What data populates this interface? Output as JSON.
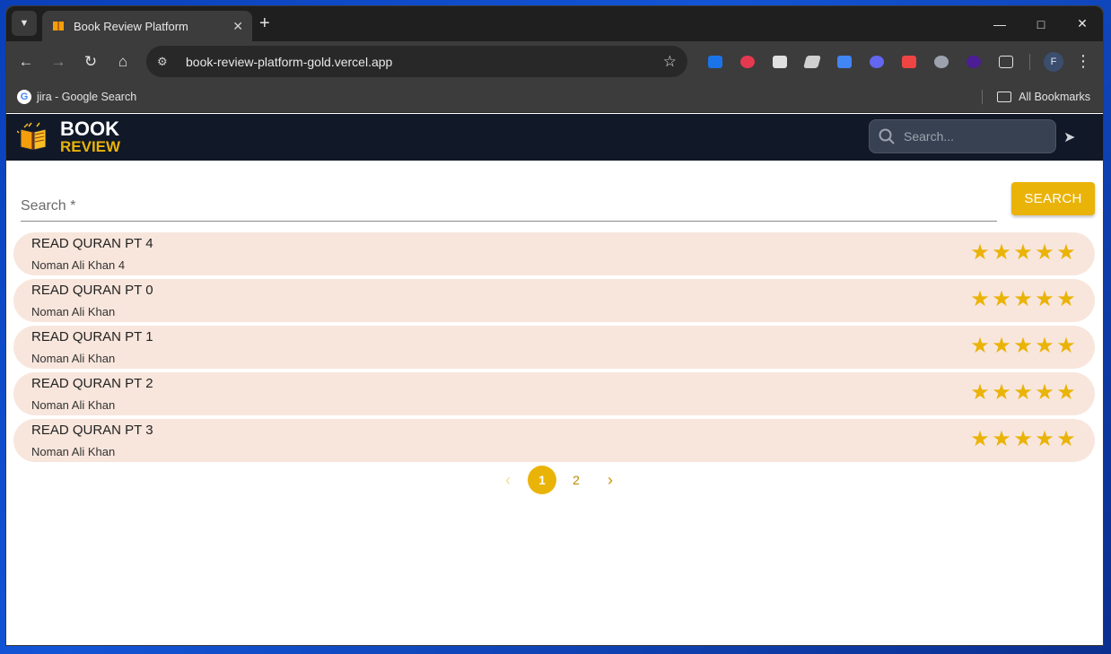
{
  "browser": {
    "tab_title": "Book Review Platform",
    "url": "book-review-platform-gold.vercel.app",
    "bookmarks": [
      {
        "label": "jira - Google Search"
      }
    ],
    "all_bookmarks_label": "All Bookmarks",
    "profile_initial": "F"
  },
  "app": {
    "logo_line1": "BOOK",
    "logo_line2": "REVIEW",
    "header_search_placeholder": "Search...",
    "search_label": "Search *",
    "search_button": "SEARCH",
    "accent_color": "#eab308"
  },
  "books": [
    {
      "title": "READ QURAN PT 4",
      "author": "Noman Ali Khan 4",
      "rating": 5
    },
    {
      "title": "READ QURAN PT 0",
      "author": "Noman Ali Khan",
      "rating": 5
    },
    {
      "title": "READ QURAN PT 1",
      "author": "Noman Ali Khan",
      "rating": 5
    },
    {
      "title": "READ QURAN PT 2",
      "author": "Noman Ali Khan",
      "rating": 5
    },
    {
      "title": "READ QURAN PT 3",
      "author": "Noman Ali Khan",
      "rating": 5
    }
  ],
  "pagination": {
    "pages": [
      "1",
      "2"
    ],
    "current": "1"
  }
}
